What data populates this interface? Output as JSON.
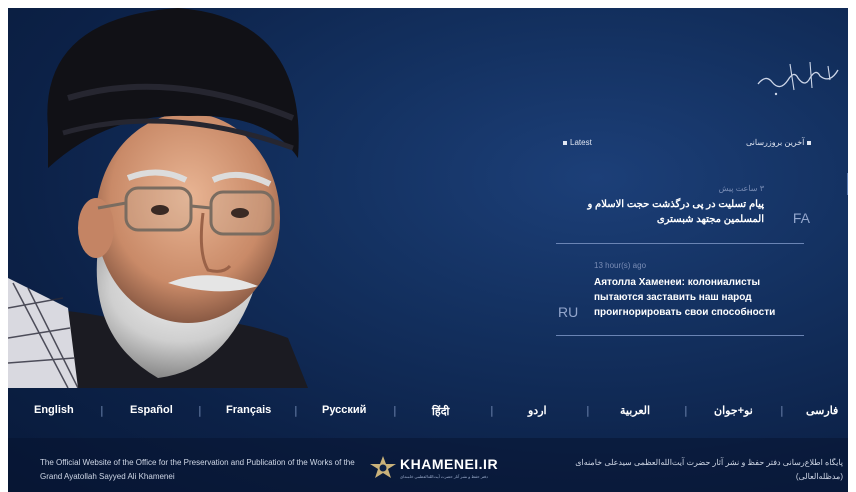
{
  "latest_label": "Latest",
  "latest_fa_label": "آخرین بروزرسانی",
  "news": [
    {
      "lang": "FA",
      "time": "۳ ساعت پیش",
      "title": "پیام تسلیت در پی درگذشت حجت الاسلام و المسلمین مجتهد شبستری"
    },
    {
      "lang": "RU",
      "time": "13 hour(s) ago",
      "title": "Аятолла Хаменеи: колониалисты пытаются заставить наш народ проигнорировать свои способности"
    }
  ],
  "languages": [
    "English",
    "Español",
    "Français",
    "Русский",
    "हिंदी",
    "اردو",
    "العربية",
    "نو+جوان",
    "فارسی"
  ],
  "footer": {
    "left_text": "The Official Website of the Office for the Preservation and Publication of the Works of the Grand Ayatollah Sayyed Ali Khamenei",
    "right_text": "پایگاه اطلاع‌رسانی دفتر حفظ و نشر آثار حضرت آیت‌الله‌العظمی سیدعلی خامنه‌ای (مدظله‌العالی)",
    "logo_text": "KHAMENEI.IR",
    "logo_sub": "دفتر حفظ و نشر آثار حضرت آیت‌الله‌العظمی خامنه‌ای"
  },
  "colors": {
    "background": "#0f2a55",
    "accent": "#93a6cc"
  }
}
